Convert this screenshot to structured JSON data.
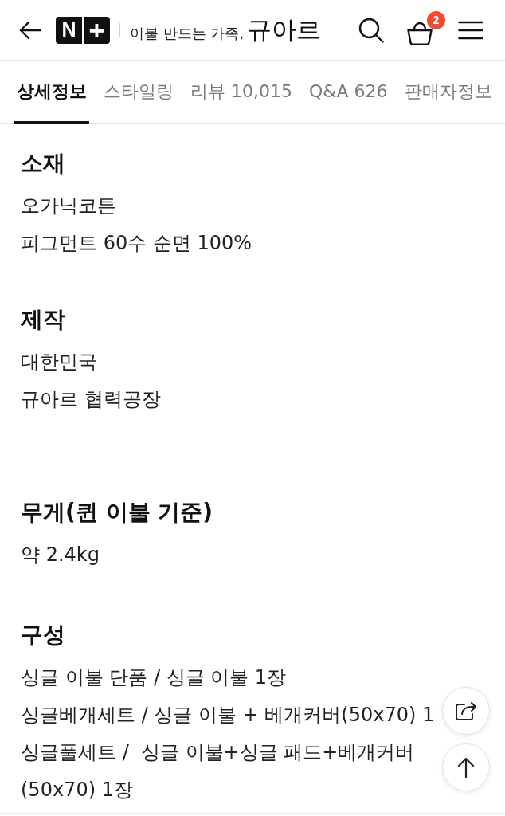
{
  "header": {
    "logo": {
      "tiles": [
        "N",
        "+"
      ],
      "tagline": "이불 만드는 가족,",
      "brand": "규아르"
    },
    "cart_count": "2"
  },
  "tabs": [
    {
      "label": "상세정보",
      "selected": true
    },
    {
      "label": "스타일링",
      "selected": false
    },
    {
      "label": "리뷰 10,015",
      "selected": false
    },
    {
      "label": "Q&A 626",
      "selected": false
    },
    {
      "label": "판매자정보",
      "selected": false
    }
  ],
  "sections": [
    {
      "title": "소재",
      "lines": [
        "오가닉코튼",
        "피그먼트 60수 순면 100%"
      ]
    },
    {
      "title": "제작",
      "lines": [
        "대한민국",
        "규아르 협력공장"
      ]
    },
    {
      "title": "무게(퀸 이불 기준)",
      "lines": [
        "약 2.4kg"
      ]
    },
    {
      "title": "구성",
      "lines": [
        "싱글 이불 단품 / 싱글 이불 1장",
        "싱글베개세트 / 싱글 이불 + 베개커버(50x70) 1",
        "싱글풀세트 /  싱글 이불+싱글 패드+베개커버(50x70) 1장"
      ]
    }
  ],
  "floating_buttons": [
    {
      "kind": "share"
    },
    {
      "kind": "top"
    }
  ]
}
